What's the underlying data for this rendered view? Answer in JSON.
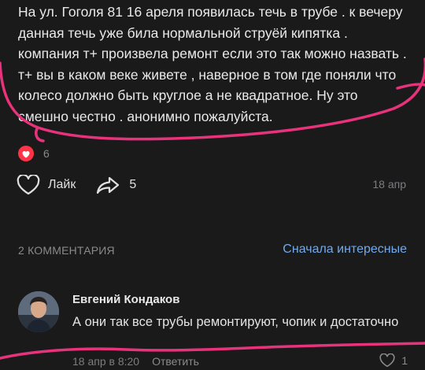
{
  "post": {
    "text": "На ул. Гоголя 81 16 ареля появилась течь в трубе . к вечеру данная течь уже била нормальной струёй кипятка . компания т+ произвела ремонт если это так можно назвать . т+ вы в каком веке живете , наверное в том где поняли что колесо должно быть круглое а не квадратное. Ну это смешно честно . анонимно пожалуйста.",
    "reaction_count": "6",
    "like_label": "Лайк",
    "share_count": "5",
    "date": "18 апр"
  },
  "comments": {
    "header": "2 КОММЕНТАРИЯ",
    "sort_label": "Сначала интересные",
    "items": [
      {
        "author": "Евгений Кондаков",
        "text": "А они так все трубы ремонтируют, чопик и достаточно",
        "time": "18 апр в 8:20",
        "reply_label": "Ответить",
        "like_count": "1"
      }
    ]
  },
  "colors": {
    "background": "#1a1a1b",
    "accent_link": "#71aaeb",
    "reaction_heart": "#ff3347",
    "annotation_stroke": "#e8327c"
  }
}
